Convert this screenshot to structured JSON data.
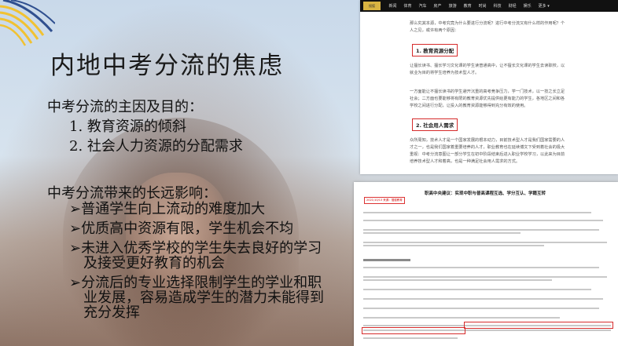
{
  "slide": {
    "title": "内地中考分流的焦虑",
    "section1_heading": "中考分流的主因及目的：",
    "section1_items": [
      "1.  教育资源的倾斜",
      "2.  社会人力资源的分配需求"
    ],
    "section2_heading": "中考分流带来的长远影响：",
    "bullet_icon": "arrow-bullet",
    "bullet_glyph": "➢",
    "section2_items": [
      [
        "普通学生向上流动的难度加大"
      ],
      [
        "优质高中资源有限，学生机会不均"
      ],
      [
        "未进入优秀学校的学生失去良好的学习",
        "及接受更好教育的机会"
      ],
      [
        "分流后的专业选择限制学生的学业和职",
        "业发展，容易造成学生的潜力未能得到",
        "充分发挥"
      ]
    ]
  },
  "article1": {
    "logo_text": "搜狐",
    "nav": [
      "新闻",
      "体育",
      "汽车",
      "房产",
      "旅游",
      "教育",
      "时尚",
      "科技",
      "财经",
      "娱乐",
      "更多 ▾"
    ],
    "intro": "那么究其本源，中考究竟为什么要进行分流呢？进行中考分流又有什么样的作用呢？个人之见，或许有两个原因：",
    "heading1": "1. 教育资源分配",
    "para1": "让擅长读书、擅长学习文化课的学生读普通高中，让不擅长文化课的学生去读职校，以就业为目的将学生培养为技术型人才。",
    "para2": "一方面能让不擅长读书的学生避开沉重的高考竞争压力，学一门技术，以一技之长立足社会；二方面也要能够将有限的教育资源优先提供给更有能力的学生，各地区之间和各学校之间进行分配，让投入的教育资源能够得到充分有效的使用。",
    "heading2": "2. 社会用人需求",
    "para3": "众所周知，技术人才是一个国家发展的根本动力，目前技术型人才是我们国家需要的人才之一，也是我们国家着重要培养的人才，职业教育也在延续博文下受到着社会的极大重视：中考分流意图让一部分学生在初中阶段结束后进入职业学校学习，以此来为目前培养技术型人才和着高，也是一种满足社会用人需求的方式。"
  },
  "article2": {
    "title": "职高中央建议：实现中职与普高课程互选、学分互认、学籍互转",
    "meta": "2021/10/13  来源：搜狐教育"
  }
}
